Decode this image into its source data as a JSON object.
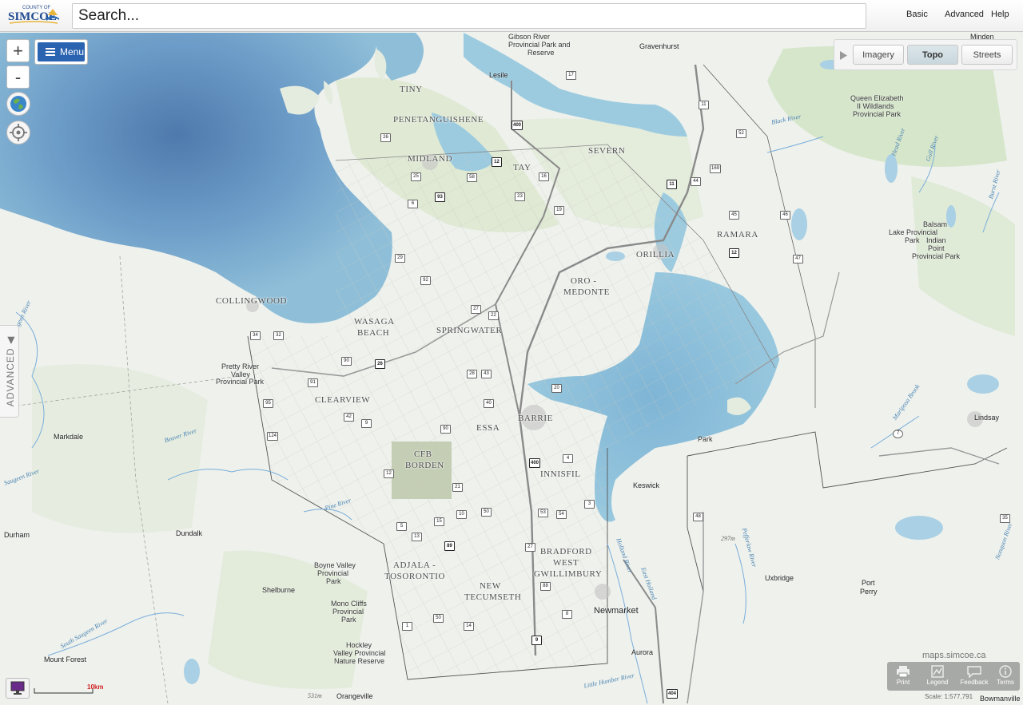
{
  "header": {
    "logo_small": "COUNTY OF",
    "logo_main": "SIMCOE",
    "search_placeholder": "Search...",
    "links": {
      "basic": "Basic",
      "advanced": "Advanced",
      "help": "Help"
    }
  },
  "controls": {
    "zoom_in": "+",
    "zoom_out": "-",
    "menu": "Menu",
    "advanced_tab": "ADVANCED"
  },
  "basemap": {
    "imagery": "Imagery",
    "topo": "Topo",
    "streets": "Streets",
    "active": "Topo"
  },
  "tools": {
    "print": "Print",
    "legend": "Legend",
    "feedback": "Feedback",
    "terms": "Terms"
  },
  "footer": {
    "site": "maps.simcoe.ca",
    "scale": "Scale: 1:577,791",
    "scalebar": "10km"
  },
  "colors": {
    "water": "#7eb1cf",
    "deep_water": "#5a8fbc",
    "land": "#eef1ec",
    "forest": "#d3e3c6",
    "menu_blue": "#2a63b0"
  },
  "map": {
    "municipalities": [
      "TINY",
      "PENETANGUISHENE",
      "MIDLAND",
      "TAY",
      "SEVERN",
      "RAMARA",
      "ORILLIA",
      "ORO -",
      "MEDONTE",
      "COLLINGWOOD",
      "WASAGA",
      "BEACH",
      "SPRINGWATER",
      "CLEARVIEW",
      "BARRIE",
      "ESSA",
      "CFB",
      "BORDEN",
      "INNISFIL",
      "ADJALA -",
      "TOSORONTIO",
      "NEW",
      "TECUMSETH",
      "BRADFORD",
      "WEST",
      "GWILLIMBURY"
    ],
    "towns": [
      "Gravenhurst",
      "Minden",
      "Markdale",
      "Durham",
      "Dundalk",
      "Shelburne",
      "Mount Forest",
      "Orangeville",
      "Keswick",
      "Newmarket",
      "Aurora",
      "Uxbridge",
      "Port",
      "Perry",
      "Lindsay",
      "Bowmanville"
    ],
    "parks": [
      "Queen Elizabeth",
      "II Wildlands",
      "Provincial Park",
      "Balsam",
      "Lake Provincial",
      "Park",
      "Indian",
      "Point",
      "Provincial Park",
      "Pretty River",
      "Valley",
      "Provincial Park",
      "Boyne Valley",
      "Provincial",
      "Park",
      "Mono Cliffs",
      "Provincial",
      "Park",
      "Hockley",
      "Valley Provincial",
      "Nature Reserve",
      "Park"
    ],
    "water_labels": [
      "Black River",
      "Head River",
      "Gull River",
      "Burnt River",
      "Beaver River",
      "Saugeen River",
      "Pine River",
      "South Saugeen River",
      "Holland River",
      "East Holland",
      "Pefferlaw River",
      "Mariposa Brook",
      "Nonquon River",
      "Little Humber River",
      "Saugeen River"
    ],
    "top_labels": [
      "Gibson River",
      "Provincial Park and",
      "Reserve",
      "Lesile"
    ],
    "elevations": [
      "297m",
      "531m"
    ],
    "highway_numbers": [
      "17",
      "11",
      "400",
      "12",
      "16",
      "52",
      "169",
      "11",
      "44",
      "45",
      "46",
      "12",
      "47",
      "26",
      "25",
      "58",
      "93",
      "6",
      "23",
      "19",
      "29",
      "92",
      "27",
      "22",
      "34",
      "32",
      "26",
      "90",
      "91",
      "28",
      "43",
      "40",
      "20",
      "95",
      "42",
      "9",
      "124",
      "90",
      "12",
      "21",
      "400",
      "4",
      "10",
      "50",
      "53",
      "54",
      "3",
      "5",
      "15",
      "13",
      "89",
      "27",
      "88",
      "50",
      "14",
      "1",
      "9",
      "8",
      "48",
      "7",
      "35",
      "404"
    ]
  }
}
